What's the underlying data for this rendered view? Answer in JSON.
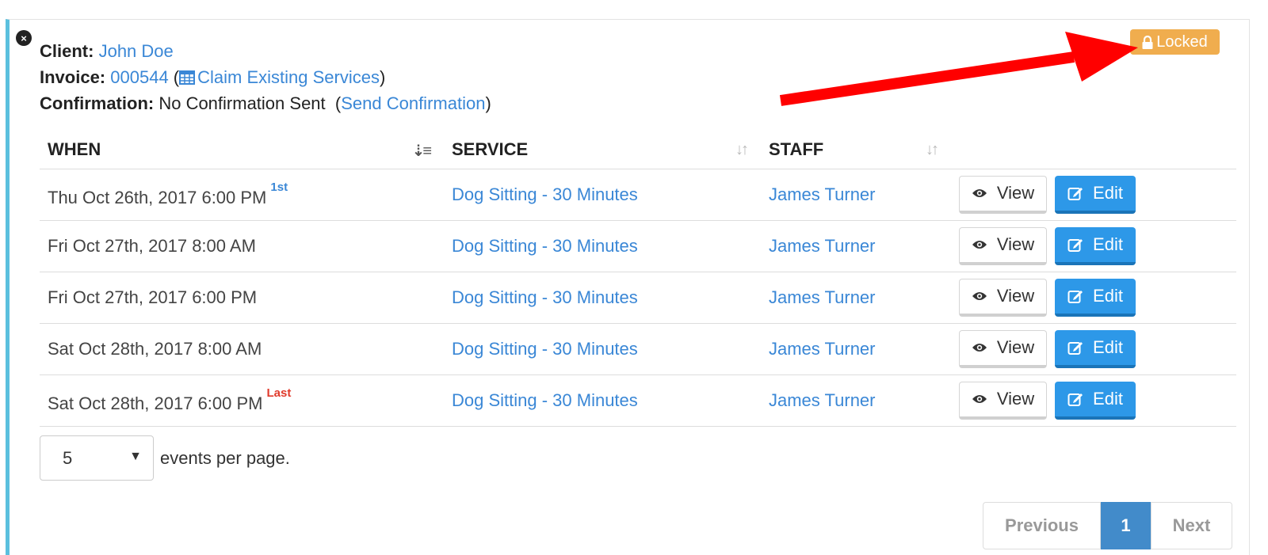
{
  "header": {
    "client_label": "Client:",
    "client_name": "John Doe",
    "invoice_label": "Invoice:",
    "invoice_number": "000544",
    "claim_link": "Claim Existing Services",
    "confirmation_label": "Confirmation:",
    "confirmation_status": "No Confirmation Sent",
    "send_confirmation_link": "Send Confirmation"
  },
  "badge": {
    "locked_label": "Locked",
    "color": "#f0ad4e"
  },
  "table": {
    "columns": [
      "WHEN",
      "SERVICE",
      "STAFF"
    ],
    "rows": [
      {
        "when": "Thu Oct 26th, 2017 6:00 PM",
        "tag": "1st",
        "service": "Dog Sitting - 30 Minutes",
        "staff": "James Turner"
      },
      {
        "when": "Fri Oct 27th, 2017 8:00 AM",
        "tag": "",
        "service": "Dog Sitting - 30 Minutes",
        "staff": "James Turner"
      },
      {
        "when": "Fri Oct 27th, 2017 6:00 PM",
        "tag": "",
        "service": "Dog Sitting - 30 Minutes",
        "staff": "James Turner"
      },
      {
        "when": "Sat Oct 28th, 2017 8:00 AM",
        "tag": "",
        "service": "Dog Sitting - 30 Minutes",
        "staff": "James Turner"
      },
      {
        "when": "Sat Oct 28th, 2017 6:00 PM",
        "tag": "Last",
        "service": "Dog Sitting - 30 Minutes",
        "staff": "James Turner"
      }
    ],
    "view_label": "View",
    "edit_label": "Edit"
  },
  "pagination": {
    "per_page_value": "5",
    "per_page_suffix": "events per page.",
    "previous_label": "Previous",
    "current_page": "1",
    "next_label": "Next"
  },
  "colors": {
    "accent": "#2d98e8",
    "link": "#3a87d6",
    "panel_border": "#5bc0de",
    "arrow": "#ff0000"
  }
}
